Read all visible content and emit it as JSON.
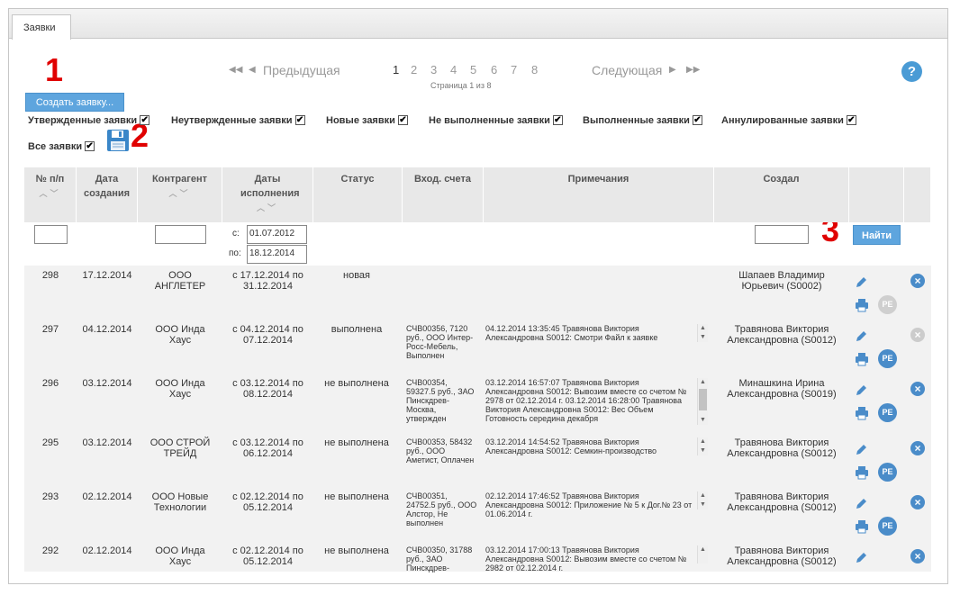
{
  "tab": {
    "label": "Заявки"
  },
  "annotations": [
    "1",
    "2",
    "3"
  ],
  "pager": {
    "prev_label": "Предыдущая",
    "next_label": "Следующая",
    "pages": [
      "1",
      "2",
      "3",
      "4",
      "5",
      "6",
      "7",
      "8"
    ],
    "current_page": "1",
    "page_info": "Страница 1 из 8"
  },
  "help_label": "?",
  "create_button": "Создать заявку...",
  "filters": [
    {
      "label": "Утвержденные заявки",
      "checked": true
    },
    {
      "label": "Неутвержденные заявки",
      "checked": true
    },
    {
      "label": "Новые заявки",
      "checked": true
    },
    {
      "label": "Не выполненные заявки",
      "checked": true
    },
    {
      "label": "Выполненные заявки",
      "checked": true
    },
    {
      "label": "Аннулированные заявки",
      "checked": true
    },
    {
      "label": "Все заявки",
      "checked": true
    }
  ],
  "columns": [
    "№ п/п",
    "Дата создания",
    "Контрагент",
    "Даты исполнения",
    "Статус",
    "Вход. счета",
    "Примечания",
    "Создал"
  ],
  "search": {
    "date_from_label": "с:",
    "date_from": "01.07.2012",
    "date_to_label": "по:",
    "date_to": "18.12.2014",
    "find_button": "Найти"
  },
  "rows": [
    {
      "num": "298",
      "date": "17.12.2014",
      "contractor": "ООО АНГЛЕТЕР",
      "exec": "с 17.12.2014 по 31.12.2014",
      "status": "новая",
      "invoices": "",
      "notes": "",
      "author": "Шапаев Владимир Юрьевич (S0002)",
      "pe": "РЕ",
      "pe_active": false,
      "delete_active": true
    },
    {
      "num": "297",
      "date": "04.12.2014",
      "contractor": "ООО Инда Хаус",
      "exec": "с 04.12.2014 по 07.12.2014",
      "status": "выполнена",
      "invoices": "СЧВ00356, 7120 руб., ООО Интер-Росс-Мебель, Выполнен",
      "notes": "04.12.2014 13:35:45 Травянова Виктория Александровна S0012: Смотри Файл к заявке",
      "author": "Травянова Виктория Александровна (S0012)",
      "pe": "РЕ",
      "pe_active": true,
      "delete_active": false
    },
    {
      "num": "296",
      "date": "03.12.2014",
      "contractor": "ООО Инда Хаус",
      "exec": "с 03.12.2014 по 08.12.2014",
      "status": "не выполнена",
      "invoices": "СЧВ00354, 59327.5 руб., ЗАО Пинскдрев-Москва, утвержден",
      "notes": "03.12.2014 16:57:07 Травянова Виктория Александровна S0012: Вывозим вместе со счетом № 2978 от 02.12.2014 г. 03.12.2014 16:28:00 Травянова Виктория Александровна S0012: Вес Объем Готовность середина декабря",
      "author": "Минашкина Ирина Александровна (S0019)",
      "pe": "РЕ",
      "pe_active": true,
      "delete_active": true
    },
    {
      "num": "295",
      "date": "03.12.2014",
      "contractor": "ООО СТРОЙ ТРЕЙД",
      "exec": "с 03.12.2014 по 06.12.2014",
      "status": "не выполнена",
      "invoices": "СЧВ00353, 58432 руб., ООО Аметист, Оплачен",
      "notes": "03.12.2014 14:54:52 Травянова Виктория Александровна S0012: Семкин-производство",
      "author": "Травянова Виктория Александровна (S0012)",
      "pe": "РЕ",
      "pe_active": true,
      "delete_active": true
    },
    {
      "num": "293",
      "date": "02.12.2014",
      "contractor": "ООО Новые Технологии",
      "exec": "с 02.12.2014 по 05.12.2014",
      "status": "не выполнена",
      "invoices": "СЧВ00351, 24752.5 руб., ООО Алстор, Не выполнен",
      "notes": "02.12.2014 17:46:52 Травянова Виктория Александровна S0012: Приложение № 5 к Дог.№ 23 от 01.06.2014 г.",
      "author": "Травянова Виктория Александровна (S0012)",
      "pe": "РЕ",
      "pe_active": true,
      "delete_active": true
    },
    {
      "num": "292",
      "date": "02.12.2014",
      "contractor": "ООО Инда Хаус",
      "exec": "с 02.12.2014 по 05.12.2014",
      "status": "не выполнена",
      "invoices": "СЧВ00350, 31788 руб., ЗАО Пинскдрев-",
      "notes": "03.12.2014 17:00:13 Травянова Виктория Александровна S0012: Вывозим вместе со счетом № 2982 от 02.12.2014 г.",
      "author": "Травянова Виктория Александровна (S0012)",
      "pe": "РЕ",
      "pe_active": true,
      "delete_active": true
    }
  ],
  "colors": {
    "accent": "#5ea5de",
    "icon_blue": "#4a8cc9",
    "disabled": "#cccccc",
    "annotation_red": "#e00000"
  }
}
